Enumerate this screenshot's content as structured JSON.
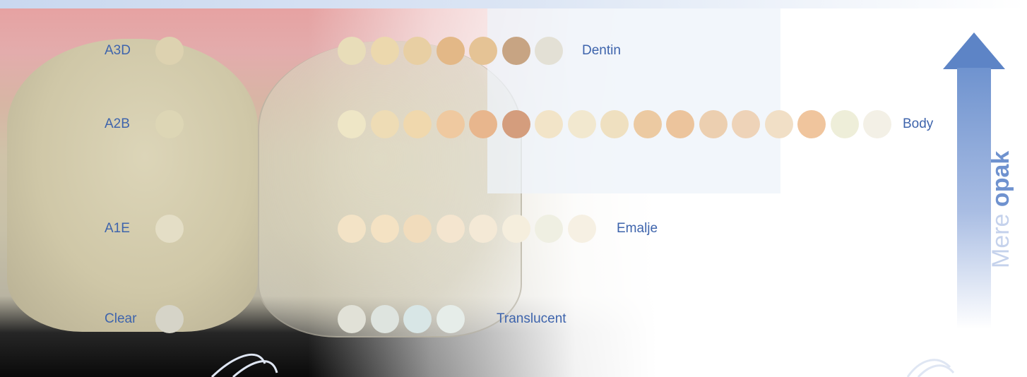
{
  "rows": [
    {
      "sample_label": "A3D",
      "sample_color": "#ddd2b0",
      "category": "Dentin",
      "swatches": [
        "#e8ddb9",
        "#ecd8ad",
        "#e8cfa3",
        "#e3b887",
        "#e5c395",
        "#c7a483",
        "#e3e0d5"
      ]
    },
    {
      "sample_label": "A2B",
      "sample_color": "#ddd6b5",
      "category": "Body",
      "swatches": [
        "#eee6c6",
        "#eedcb5",
        "#f0d8ad",
        "#efc9a0",
        "#e8b68d",
        "#d49d7d",
        "#f2e4c8",
        "#f2e8cf",
        "#efe0c0",
        "#eccaa2",
        "#ecc49c",
        "#eccfb0",
        "#eed3b8",
        "#f1dfc6",
        "#f0c59d",
        "#eeeed9",
        "#f3f0e6"
      ]
    },
    {
      "sample_label": "A1E",
      "sample_color": "#e4dec6",
      "category": "Emalje",
      "swatches": [
        "#f3e3c6",
        "#f4e2c3",
        "#f1dcbc",
        "#f4e5cf",
        "#f4e9d6",
        "#f5eedd",
        "#efefe2",
        "#f6f0e3"
      ]
    },
    {
      "sample_label": "Clear",
      "sample_color": "#d6d4c8",
      "category": "Translucent",
      "swatches": [
        "#e1e1d7",
        "#dee4df",
        "#d8e6e6",
        "#e6ede9"
      ]
    }
  ],
  "arrow": {
    "text_light": "Mere ",
    "text_bold": "opak",
    "color": "#6f92cf"
  },
  "colors": {
    "label": "#3e64ac"
  }
}
